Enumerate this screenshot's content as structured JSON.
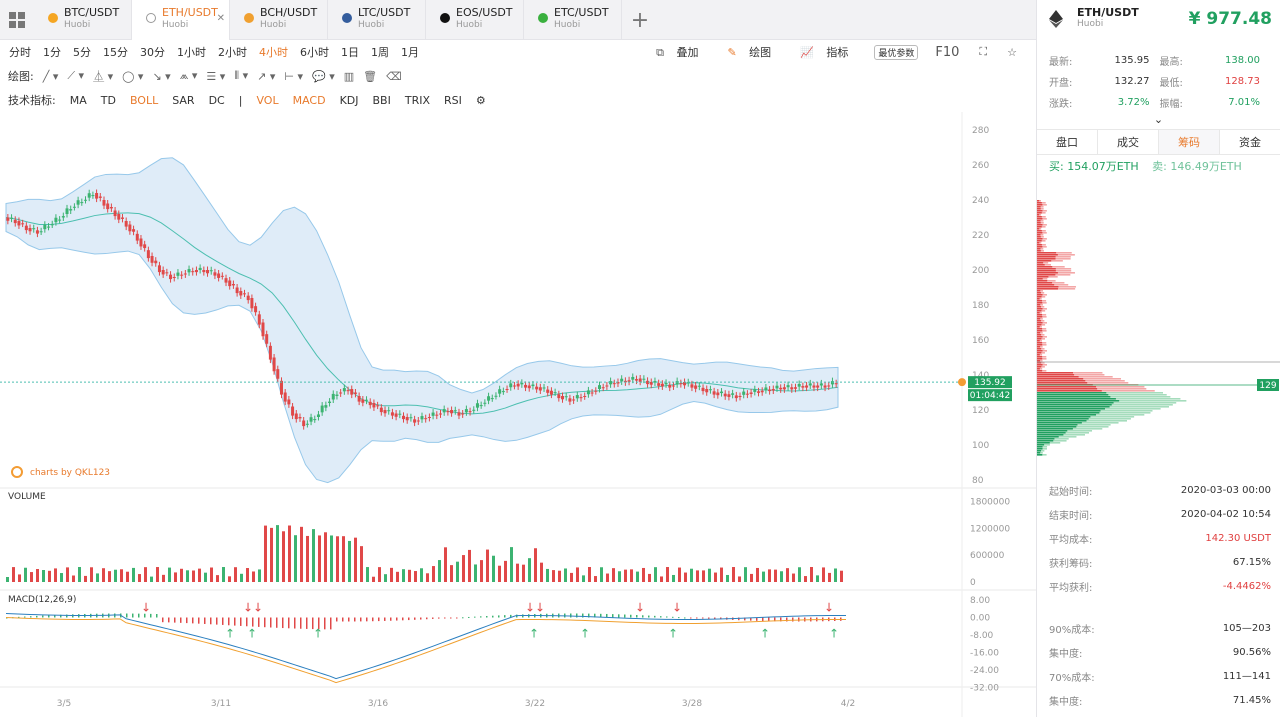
{
  "tabs": [
    {
      "pair": "BTC/USDT",
      "exchange": "Huobi",
      "color": "#f5a623"
    },
    {
      "pair": "ETH/USDT",
      "exchange": "Huobi",
      "color": "#444444"
    },
    {
      "pair": "BCH/USDT",
      "exchange": "Huobi",
      "color": "#f0a030"
    },
    {
      "pair": "LTC/USDT",
      "exchange": "Huobi",
      "color": "#345d9d"
    },
    {
      "pair": "EOS/USDT",
      "exchange": "Huobi",
      "color": "#111111"
    },
    {
      "pair": "ETC/USDT",
      "exchange": "Huobi",
      "color": "#3ab03e"
    }
  ],
  "timeframes": [
    "分时",
    "1分",
    "5分",
    "15分",
    "30分",
    "1小时",
    "2小时",
    "4小时",
    "6小时",
    "1日",
    "1周",
    "1月"
  ],
  "active_timeframe": "4小时",
  "tools": {
    "overlay": "叠加",
    "draw": "绘图",
    "indicator": "指标",
    "optimal": "最优参数",
    "f10": "F10"
  },
  "draw_label": "绘图:",
  "indicator_label": "技术指标:",
  "indicators": [
    "MA",
    "TD",
    "BOLL",
    "SAR",
    "DC",
    "|",
    "VOL",
    "MACD",
    "KDJ",
    "BBI",
    "TRIX",
    "RSI"
  ],
  "active_indicators": [
    "BOLL",
    "VOL",
    "MACD"
  ],
  "header": {
    "pair": "ETH/USDT",
    "exchange": "Huobi",
    "price": "¥ 977.48"
  },
  "stats": [
    {
      "k1": "最新:",
      "v1": "135.95",
      "k2": "最高:",
      "v2": "138.00",
      "c2": "#21a060"
    },
    {
      "k1": "开盘:",
      "v1": "132.27",
      "k2": "最低:",
      "v2": "128.73",
      "c2": "#e04040"
    },
    {
      "k1": "涨跌:",
      "v1": "3.72%",
      "k2": "振幅:",
      "v2": "7.01%",
      "c1": "#21a060",
      "c2": "#21a060"
    }
  ],
  "side_tabs": [
    "盘口",
    "成交",
    "筹码",
    "资金"
  ],
  "active_side_tab": "筹码",
  "buy": "买: 154.07万ETH",
  "sell": "卖: 146.49万ETH",
  "chip_price_label": "129",
  "info": [
    {
      "k": "起始时间:",
      "v": "2020-03-03 00:00"
    },
    {
      "k": "结束时间:",
      "v": "2020-04-02 10:54"
    },
    {
      "k": "平均成本:",
      "v": "142.30 USDT",
      "c": "#e04040"
    },
    {
      "k": "获利筹码:",
      "v": "67.15%"
    },
    {
      "k": "平均获利:",
      "v": "-4.4462%",
      "c": "#e04040"
    },
    {
      "k": "",
      "v": ""
    },
    {
      "k": "90%成本:",
      "v": "105—203"
    },
    {
      "k": "集中度:",
      "v": "90.56%"
    },
    {
      "k": "70%成本:",
      "v": "111—141"
    },
    {
      "k": "集中度:",
      "v": "71.45%"
    }
  ],
  "chart_data": {
    "type": "candlestick",
    "price_axis": [
      "280",
      "260",
      "240",
      "220",
      "200",
      "180",
      "160",
      "140",
      "120",
      "100",
      "80"
    ],
    "volume_axis": [
      "1800000",
      "1200000",
      "600000",
      "0"
    ],
    "macd_axis": [
      "8.00",
      "0.00",
      "-8.00",
      "-16.00",
      "-24.00",
      "-32.00"
    ],
    "x_labels": [
      "3/5",
      "3/11",
      "3/16",
      "3/22",
      "3/28",
      "4/2"
    ],
    "current_price": "135.92",
    "countdown": "01:04:42",
    "watermark": "charts by QKL123",
    "volume_title": "VOLUME",
    "macd_title": "MACD(12,26,9)",
    "close_path": [
      230,
      228,
      224,
      222,
      226,
      230,
      236,
      240,
      244,
      238,
      232,
      226,
      218,
      208,
      200,
      196,
      198,
      200,
      200,
      198,
      194,
      188,
      184,
      170,
      150,
      130,
      118,
      112,
      116,
      124,
      130,
      132,
      126,
      124,
      120,
      118,
      116,
      114,
      116,
      118,
      120,
      118,
      120,
      124,
      128,
      132,
      135,
      134,
      133,
      131,
      128,
      126,
      128,
      131,
      134,
      136,
      137,
      138,
      136,
      135,
      134,
      136,
      134,
      132,
      130,
      129,
      128,
      130,
      131,
      132,
      133,
      133,
      134,
      134,
      134,
      135.95
    ]
  }
}
